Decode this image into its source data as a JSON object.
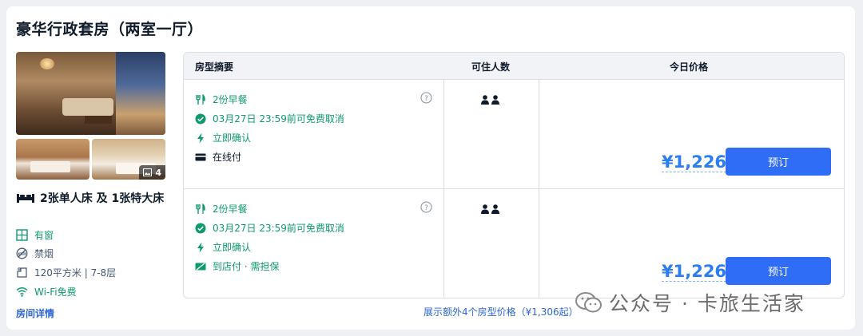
{
  "room": {
    "title": "豪华行政套房（两室一厅）",
    "photo_count": "4",
    "bed": "2张单人床 及 1张特大床",
    "facilities": [
      {
        "icon": "window-icon",
        "label": "有窗"
      },
      {
        "icon": "no-smoking-icon",
        "label": "禁烟"
      },
      {
        "icon": "area-icon",
        "label": "120平方米 | 7-8层"
      },
      {
        "icon": "wifi-icon",
        "label": "Wi-Fi免费"
      }
    ],
    "details_link": "房间详情"
  },
  "table": {
    "headers": [
      "房型摘要",
      "可住人数",
      "今日价格"
    ],
    "rows": [
      {
        "perks": [
          "2份早餐",
          "03月27日 23:59前可免费取消",
          "立即确认",
          "在线付"
        ],
        "price": "¥1,226",
        "book": "预订"
      },
      {
        "perks": [
          "2份早餐",
          "03月27日 23:59前可免费取消",
          "立即确认",
          "到店付 · 需担保"
        ],
        "price": "¥1,226",
        "book": "预订"
      }
    ]
  },
  "more_link": "展示额外4个房型价格（¥1,306起）",
  "watermark": "公众号 · 卡旅生活家",
  "colors": {
    "accent": "#2f6df6",
    "green": "#0d9b6a",
    "price": "#2c7df0"
  }
}
